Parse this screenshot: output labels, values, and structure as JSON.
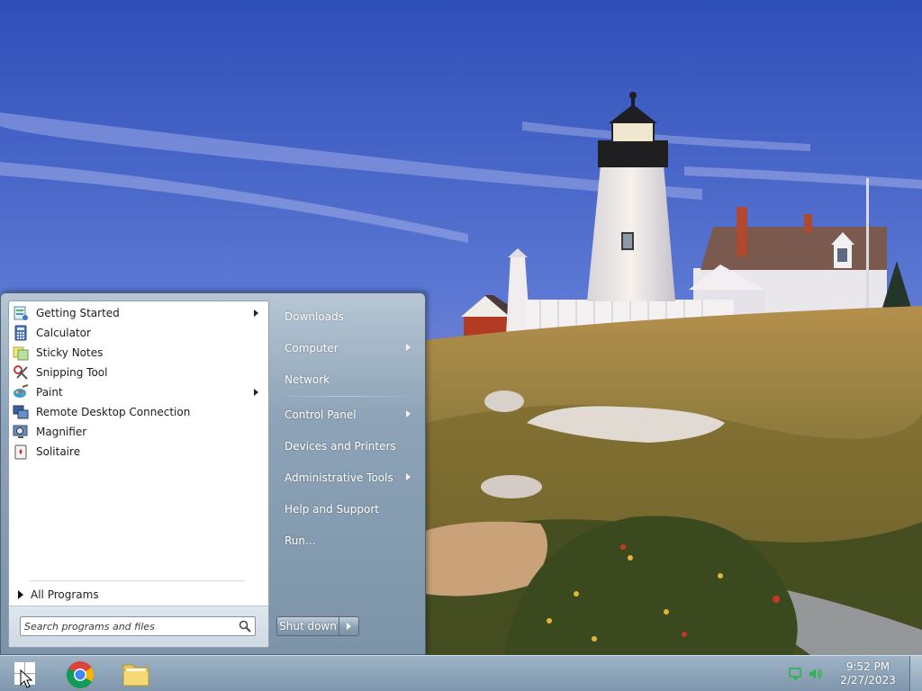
{
  "start_menu": {
    "programs": [
      {
        "label": "Getting Started",
        "icon": "getting-started-icon",
        "has_submenu": true
      },
      {
        "label": "Calculator",
        "icon": "calculator-icon",
        "has_submenu": false
      },
      {
        "label": "Sticky Notes",
        "icon": "sticky-notes-icon",
        "has_submenu": false
      },
      {
        "label": "Snipping Tool",
        "icon": "snipping-tool-icon",
        "has_submenu": false
      },
      {
        "label": "Paint",
        "icon": "paint-icon",
        "has_submenu": true
      },
      {
        "label": "Remote Desktop Connection",
        "icon": "remote-desktop-icon",
        "has_submenu": false
      },
      {
        "label": "Magnifier",
        "icon": "magnifier-icon",
        "has_submenu": false
      },
      {
        "label": "Solitaire",
        "icon": "solitaire-icon",
        "has_submenu": false
      }
    ],
    "all_programs_label": "All Programs",
    "search": {
      "placeholder": "Search programs and files",
      "value": ""
    },
    "places": [
      {
        "label": "Downloads",
        "has_submenu": false
      },
      {
        "label": "Computer",
        "has_submenu": true
      },
      {
        "label": "Network",
        "has_submenu": false
      },
      {
        "label": "Control Panel",
        "has_submenu": true
      },
      {
        "label": "Devices and Printers",
        "has_submenu": false
      },
      {
        "label": "Administrative Tools",
        "has_submenu": true
      },
      {
        "label": "Help and Support",
        "has_submenu": false
      },
      {
        "label": "Run...",
        "has_submenu": false
      }
    ],
    "shutdown_label": "Shut down"
  },
  "taskbar": {
    "pinned": [
      {
        "icon": "windows-start-icon"
      },
      {
        "icon": "chrome-icon"
      },
      {
        "icon": "file-explorer-icon"
      }
    ],
    "tray_icons": [
      "network-icon",
      "volume-icon"
    ],
    "clock": {
      "time": "9:52 PM",
      "date": "2/27/2023"
    }
  },
  "colors": {
    "start_menu_glass": "#8ea3b7",
    "taskbar": "#8fa5ba",
    "sky": "#3e5fc4",
    "tray_icons": "#2fb34f"
  }
}
